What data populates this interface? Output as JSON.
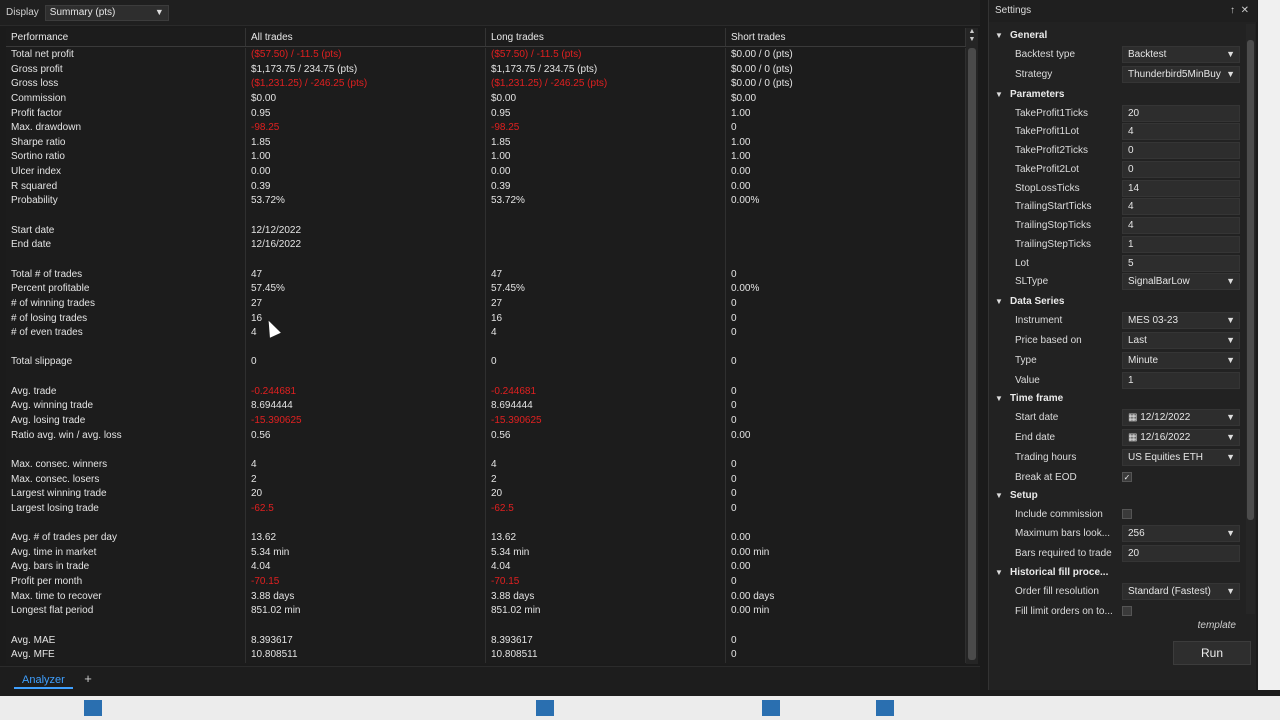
{
  "topbar": {
    "display_label": "Display",
    "display_value": "Summary (pts)"
  },
  "grid": {
    "headers": [
      "Performance",
      "All trades",
      "Long trades",
      "Short trades"
    ],
    "rows": [
      {
        "label": "Total net profit",
        "all": "($57.50) / -11.5 (pts)",
        "long": "($57.50) / -11.5 (pts)",
        "short": "$0.00 / 0 (pts)",
        "neg": true
      },
      {
        "label": "Gross profit",
        "all": "$1,173.75 / 234.75 (pts)",
        "long": "$1,173.75 / 234.75 (pts)",
        "short": "$0.00 / 0 (pts)",
        "neg": false
      },
      {
        "label": "Gross loss",
        "all": "($1,231.25) / -246.25 (pts)",
        "long": "($1,231.25) / -246.25 (pts)",
        "short": "$0.00 / 0 (pts)",
        "neg": true
      },
      {
        "label": "Commission",
        "all": "$0.00",
        "long": "$0.00",
        "short": "$0.00",
        "neg": false
      },
      {
        "label": "Profit factor",
        "all": "0.95",
        "long": "0.95",
        "short": "1.00",
        "neg": false
      },
      {
        "label": "Max. drawdown",
        "all": "-98.25",
        "long": "-98.25",
        "short": "0",
        "neg": true
      },
      {
        "label": "Sharpe ratio",
        "all": "1.85",
        "long": "1.85",
        "short": "1.00",
        "neg": false
      },
      {
        "label": "Sortino ratio",
        "all": "1.00",
        "long": "1.00",
        "short": "1.00",
        "neg": false
      },
      {
        "label": "Ulcer index",
        "all": "0.00",
        "long": "0.00",
        "short": "0.00",
        "neg": false
      },
      {
        "label": "R squared",
        "all": "0.39",
        "long": "0.39",
        "short": "0.00",
        "neg": false
      },
      {
        "label": "Probability",
        "all": "53.72%",
        "long": "53.72%",
        "short": "0.00%",
        "neg": false
      },
      {
        "label": "",
        "all": "",
        "long": "",
        "short": "",
        "neg": false
      },
      {
        "label": "Start date",
        "all": "12/12/2022",
        "long": "",
        "short": "",
        "neg": false
      },
      {
        "label": "End date",
        "all": "12/16/2022",
        "long": "",
        "short": "",
        "neg": false
      },
      {
        "label": "",
        "all": "",
        "long": "",
        "short": "",
        "neg": false
      },
      {
        "label": "Total # of trades",
        "all": "47",
        "long": "47",
        "short": "0",
        "neg": false
      },
      {
        "label": "Percent profitable",
        "all": "57.45%",
        "long": "57.45%",
        "short": "0.00%",
        "neg": false
      },
      {
        "label": "# of winning trades",
        "all": "27",
        "long": "27",
        "short": "0",
        "neg": false
      },
      {
        "label": "# of losing trades",
        "all": "16",
        "long": "16",
        "short": "0",
        "neg": false
      },
      {
        "label": "# of even trades",
        "all": "4",
        "long": "4",
        "short": "0",
        "neg": false
      },
      {
        "label": "",
        "all": "",
        "long": "",
        "short": "",
        "neg": false
      },
      {
        "label": "Total slippage",
        "all": "0",
        "long": "0",
        "short": "0",
        "neg": false
      },
      {
        "label": "",
        "all": "",
        "long": "",
        "short": "",
        "neg": false
      },
      {
        "label": "Avg. trade",
        "all": "-0.244681",
        "long": "-0.244681",
        "short": "0",
        "neg": true
      },
      {
        "label": "Avg. winning trade",
        "all": "8.694444",
        "long": "8.694444",
        "short": "0",
        "neg": false
      },
      {
        "label": "Avg. losing trade",
        "all": "-15.390625",
        "long": "-15.390625",
        "short": "0",
        "neg": true
      },
      {
        "label": "Ratio avg. win / avg. loss",
        "all": "0.56",
        "long": "0.56",
        "short": "0.00",
        "neg": false
      },
      {
        "label": "",
        "all": "",
        "long": "",
        "short": "",
        "neg": false
      },
      {
        "label": "Max. consec. winners",
        "all": "4",
        "long": "4",
        "short": "0",
        "neg": false
      },
      {
        "label": "Max. consec. losers",
        "all": "2",
        "long": "2",
        "short": "0",
        "neg": false
      },
      {
        "label": "Largest winning trade",
        "all": "20",
        "long": "20",
        "short": "0",
        "neg": false
      },
      {
        "label": "Largest losing trade",
        "all": "-62.5",
        "long": "-62.5",
        "short": "0",
        "neg": true
      },
      {
        "label": "",
        "all": "",
        "long": "",
        "short": "",
        "neg": false
      },
      {
        "label": "Avg. # of trades per day",
        "all": "13.62",
        "long": "13.62",
        "short": "0.00",
        "neg": false
      },
      {
        "label": "Avg. time in market",
        "all": "5.34 min",
        "long": "5.34 min",
        "short": "0.00 min",
        "neg": false
      },
      {
        "label": "Avg. bars in trade",
        "all": "4.04",
        "long": "4.04",
        "short": "0.00",
        "neg": false
      },
      {
        "label": "Profit per month",
        "all": "-70.15",
        "long": "-70.15",
        "short": "0",
        "neg": true
      },
      {
        "label": "Max. time to recover",
        "all": "3.88 days",
        "long": "3.88 days",
        "short": "0.00 days",
        "neg": false
      },
      {
        "label": "Longest flat period",
        "all": "851.02 min",
        "long": "851.02 min",
        "short": "0.00 min",
        "neg": false
      },
      {
        "label": "",
        "all": "",
        "long": "",
        "short": "",
        "neg": false
      },
      {
        "label": "Avg. MAE",
        "all": "8.393617",
        "long": "8.393617",
        "short": "0",
        "neg": false
      },
      {
        "label": "Avg. MFE",
        "all": "10.808511",
        "long": "10.808511",
        "short": "0",
        "neg": false
      }
    ]
  },
  "bottom": {
    "tab_label": "Analyzer",
    "add_label": "+"
  },
  "settings": {
    "title": "Settings",
    "pin_glyph": "↑",
    "close_glyph": "✕",
    "template_label": "template",
    "run_label": "Run",
    "items": [
      {
        "kind": "cat",
        "label": "General"
      },
      {
        "kind": "select",
        "label": "Backtest type",
        "value": "Backtest"
      },
      {
        "kind": "select",
        "label": "Strategy",
        "value": "Thunderbird5MinBuy"
      },
      {
        "kind": "cat",
        "label": "Parameters"
      },
      {
        "kind": "text",
        "label": "TakeProfit1Ticks",
        "value": "20"
      },
      {
        "kind": "text",
        "label": "TakeProfit1Lot",
        "value": "4"
      },
      {
        "kind": "text",
        "label": "TakeProfit2Ticks",
        "value": "0"
      },
      {
        "kind": "text",
        "label": "TakeProfit2Lot",
        "value": "0"
      },
      {
        "kind": "text",
        "label": "StopLossTicks",
        "value": "14"
      },
      {
        "kind": "text",
        "label": "TrailingStartTicks",
        "value": "4"
      },
      {
        "kind": "text",
        "label": "TrailingStopTicks",
        "value": "4"
      },
      {
        "kind": "text",
        "label": "TrailingStepTicks",
        "value": "1"
      },
      {
        "kind": "text",
        "label": "Lot",
        "value": "5"
      },
      {
        "kind": "select",
        "label": "SLType",
        "value": "SignalBarLow"
      },
      {
        "kind": "cat",
        "label": "Data Series"
      },
      {
        "kind": "select",
        "label": "Instrument",
        "value": "MES 03-23"
      },
      {
        "kind": "select",
        "label": "Price based on",
        "value": "Last"
      },
      {
        "kind": "select",
        "label": "Type",
        "value": "Minute"
      },
      {
        "kind": "text",
        "label": "Value",
        "value": "1"
      },
      {
        "kind": "cat",
        "label": "Time frame"
      },
      {
        "kind": "date",
        "label": "Start date",
        "value": "12/12/2022"
      },
      {
        "kind": "date",
        "label": "End date",
        "value": "12/16/2022"
      },
      {
        "kind": "select",
        "label": "Trading hours",
        "value": "US Equities ETH"
      },
      {
        "kind": "check",
        "label": "Break at EOD",
        "value": "✓"
      },
      {
        "kind": "cat",
        "label": "Setup"
      },
      {
        "kind": "check",
        "label": "Include commission",
        "value": ""
      },
      {
        "kind": "select",
        "label": "Maximum bars look...",
        "value": "256"
      },
      {
        "kind": "text",
        "label": "Bars required to trade",
        "value": "20"
      },
      {
        "kind": "cat",
        "label": "Historical fill proce..."
      },
      {
        "kind": "select",
        "label": "Order fill resolution",
        "value": "Standard (Fastest)"
      },
      {
        "kind": "check",
        "label": "Fill limit orders on to...",
        "value": ""
      }
    ]
  },
  "colors": {
    "negative": "#e02020",
    "accent": "#3fa0ff",
    "background": "#1b1b1b"
  }
}
